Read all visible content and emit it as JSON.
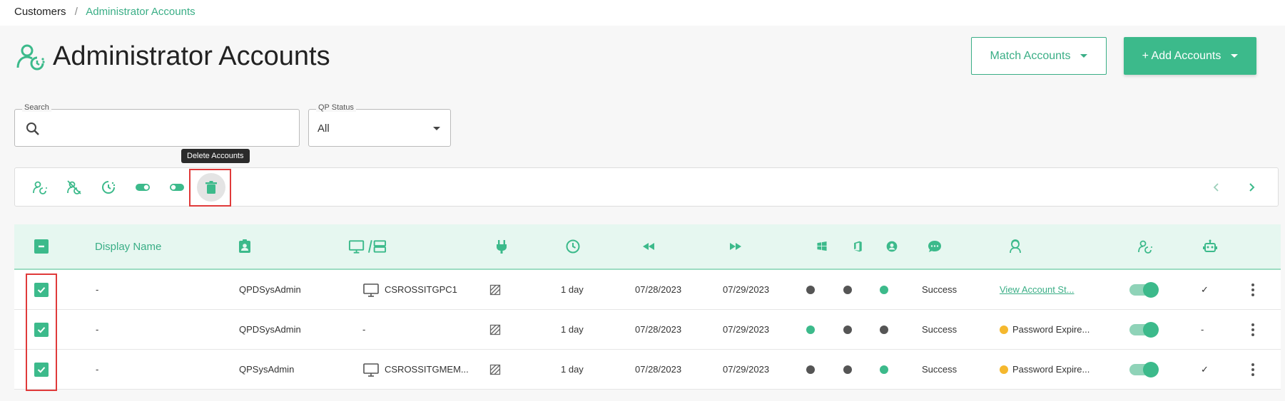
{
  "breadcrumb": {
    "root": "Customers",
    "separator": "/",
    "current": "Administrator Accounts"
  },
  "page": {
    "title": "Administrator Accounts",
    "icon": "admin-account-icon"
  },
  "header_buttons": {
    "match": "Match Accounts",
    "add": "+ Add Accounts"
  },
  "search": {
    "label": "Search",
    "value": "",
    "placeholder": ""
  },
  "qp_status": {
    "label": "QP Status",
    "value": "All"
  },
  "tooltip": {
    "text": "Delete Accounts"
  },
  "toolbar": {
    "actions": [
      {
        "icon": "assign-user-icon"
      },
      {
        "icon": "unassign-user-icon"
      },
      {
        "icon": "refresh-timer-icon"
      },
      {
        "icon": "toggle-on-icon"
      },
      {
        "icon": "toggle-off-icon"
      },
      {
        "icon": "trash-icon"
      }
    ],
    "pager": {
      "prev": "chevron-left-icon",
      "next": "chevron-right-icon"
    }
  },
  "table": {
    "headers": {
      "display_name": "Display Name",
      "icons": [
        "contact-card-icon",
        "computer-server-icon",
        "plug-icon",
        "clock-icon",
        "rewind-icon",
        "fast-forward-icon",
        "windows-icon",
        "office-icon",
        "user-circle-icon",
        "chat-icon",
        "agent-icon",
        "assign-user-icon",
        "robot-icon"
      ]
    },
    "rows": [
      {
        "display_name": "-",
        "account": "QPDSysAdmin",
        "device": "CSROSSITGPC1",
        "has_device_icon": true,
        "duration": "1 day",
        "last_date": "07/28/2023",
        "next_date": "07/29/2023",
        "dots": [
          "gray",
          "gray",
          "green"
        ],
        "result": "Success",
        "status_text": "View Account St...",
        "status_type": "link",
        "robot": "✓"
      },
      {
        "display_name": "-",
        "account": "QPDSysAdmin",
        "device": "-",
        "has_device_icon": false,
        "duration": "1 day",
        "last_date": "07/28/2023",
        "next_date": "07/29/2023",
        "dots": [
          "green",
          "gray",
          "gray"
        ],
        "result": "Success",
        "status_text": "Password Expire...",
        "status_type": "warning",
        "robot": "-"
      },
      {
        "display_name": "-",
        "account": "QPSysAdmin",
        "device": "CSROSSITGMEM...",
        "has_device_icon": true,
        "duration": "1 day",
        "last_date": "07/28/2023",
        "next_date": "07/29/2023",
        "dots": [
          "gray",
          "gray",
          "green"
        ],
        "result": "Success",
        "status_text": "Password Expire...",
        "status_type": "warning",
        "robot": "✓"
      }
    ]
  },
  "colors": {
    "accent": "#3cba8b",
    "accent_text": "#3aae86",
    "header_bg": "#e6f7f0",
    "highlight": "#e03a3a",
    "warning": "#f5b82e"
  }
}
